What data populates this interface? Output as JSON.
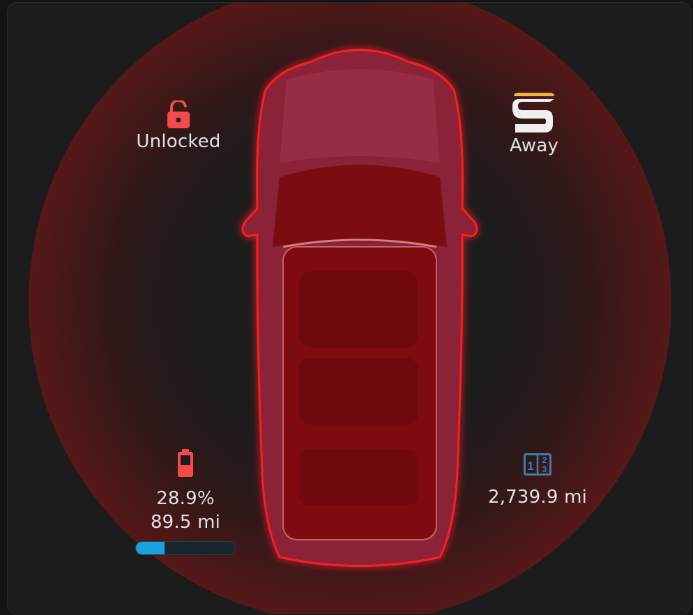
{
  "lock": {
    "icon": "lock-open-icon",
    "status": "Unlocked",
    "color": "#f44a4a"
  },
  "mode": {
    "icon": "sentry-s-logo-icon",
    "status": "Away",
    "accent": "#f2b33d"
  },
  "battery": {
    "icon": "battery-low-icon",
    "level": "28.9%",
    "range": "89.5 mi",
    "fraction": 0.289,
    "color": "#f44a4a",
    "bar_color": "#1aa3e0"
  },
  "odometer": {
    "icon": "numeric-counter-icon",
    "value": "2,739.9 mi",
    "color": "#3d7db5"
  },
  "car": {
    "highlight_color": "#ff2a2a"
  }
}
